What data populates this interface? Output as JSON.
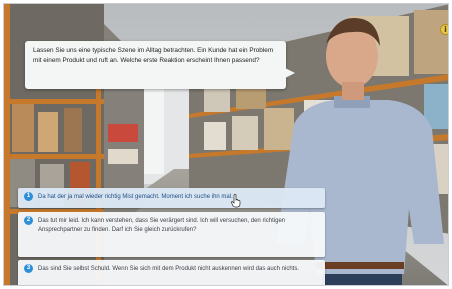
{
  "scene": {
    "prompt_text": "Lassen Sie uns eine typische Szene im Alltag betrachten. Ein Kunde hat ein Problem mit einem Produkt und ruft an. Welche erste Reaktion erscheint Ihnen passend?"
  },
  "info_icon_glyph": "i",
  "options": [
    {
      "number": "1",
      "text": "Da hat der ja mal wieder richtig Mist gemacht. Moment ich suche ihn mal."
    },
    {
      "number": "2",
      "text": "Das tut mir leid. Ich kann verstehen, dass Sie verärgert sind. Ich will versuchen, den richtigen Ansprechpartner zu finden. Darf ich Sie gleich zurückrufen?"
    },
    {
      "number": "3",
      "text": "Das sind Sie selbst Schuld. Wenn Sie sich mit dem Produkt nicht auskennen wird das auch nichts."
    }
  ],
  "colors": {
    "option_number_badge": "#2e8fd6",
    "hovered_option_text": "#1f4e86",
    "info_icon": "#e7c64e"
  },
  "icons": {
    "info": "info-icon",
    "cursor": "hand-cursor-icon"
  }
}
